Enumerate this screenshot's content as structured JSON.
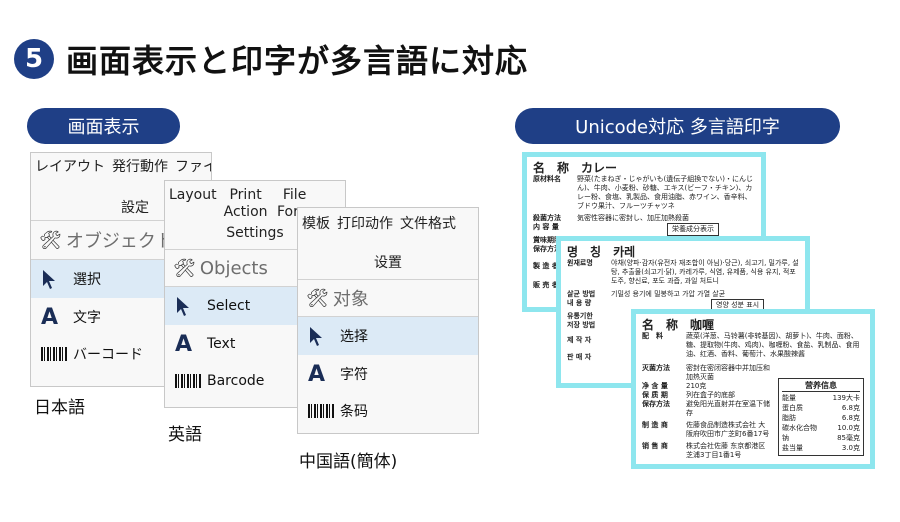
{
  "header": {
    "number": "5",
    "title": "画面表示と印字が多言語に対応"
  },
  "pills": {
    "left": "画面表示",
    "right": "Unicode対応 多言語印字"
  },
  "panels": {
    "ja": {
      "menu": [
        "レイアウト",
        "発行動作",
        "ファイル形"
      ],
      "group": "設定",
      "section": "オブジェクト",
      "items": [
        {
          "icon": "cursor-arrow-icon",
          "label": "選択"
        },
        {
          "icon": "text-a-icon",
          "label": "文字"
        },
        {
          "icon": "barcode-icon",
          "label": "バーコード"
        }
      ],
      "caption": "日本語"
    },
    "en": {
      "menu": [
        "Layout",
        "Print Action",
        "File Form"
      ],
      "group": "Settings",
      "section": "Objects",
      "items": [
        {
          "icon": "cursor-arrow-icon",
          "label": "Select"
        },
        {
          "icon": "text-a-icon",
          "label": "Text"
        },
        {
          "icon": "barcode-icon",
          "label": "Barcode"
        }
      ],
      "caption": "英語"
    },
    "zh": {
      "menu": [
        "模板",
        "打印动作",
        "文件格式"
      ],
      "group": "设置",
      "section": "对象",
      "items": [
        {
          "icon": "cursor-arrow-icon",
          "label": "选择"
        },
        {
          "icon": "text-a-icon",
          "label": "字符"
        },
        {
          "icon": "barcode-icon",
          "label": "条码"
        }
      ],
      "caption": "中国語(簡体)"
    }
  },
  "labels": {
    "ja": {
      "title": "名　称　カレー",
      "rows": [
        {
          "k": "原材料名",
          "v": "野菜(たまねぎ・じゃがいも(遺伝子組換でない)・にんじん)、牛肉、小麦粉、砂糖、エキス(ビーフ・チキン)、カレー粉、食塩、乳製品、食用油脂、赤ワイン、香辛料、ブドウ果汁、フルーツチャツネ"
        },
        {
          "k": "殺菌方法",
          "v": "気密性容器に密封し、加圧加熱殺菌"
        },
        {
          "k": "内 容 量",
          "v": ""
        },
        {
          "k": "賞味期限",
          "v": ""
        },
        {
          "k": "保存方法",
          "v": ""
        },
        {
          "k": "製 造 者",
          "v": ""
        },
        {
          "k": "販 売 者",
          "v": ""
        }
      ],
      "box": "栄養成分表示"
    },
    "ko": {
      "title": "명　칭　카레",
      "rows": [
        {
          "k": "원재료명",
          "v": "야채(양파·감자(유전자 재조합이 아님)·당근), 쇠고기, 밀가루, 설탕, 추출물(쇠고기·닭), 카레가루, 식염, 유제품, 식용 유지, 적포도주, 향신료, 포도 과즙, 과일 처트니"
        },
        {
          "k": "살균 방법",
          "v": "기밀성 용기에 밀봉하고 가압 가열 살균"
        },
        {
          "k": "내 용 량",
          "v": ""
        },
        {
          "k": "유통기한",
          "v": ""
        },
        {
          "k": "저장 방법",
          "v": ""
        },
        {
          "k": "제 작 자",
          "v": ""
        },
        {
          "k": "판 매 자",
          "v": ""
        }
      ],
      "box": "영양 성분 표시"
    },
    "zh": {
      "title": "名　称　咖喱",
      "rows": [
        {
          "k": "配　料",
          "v": "蔬菜(洋葱、马铃薯(非转基因)、胡萝卜)、牛肉、面粉、糖、提取物(牛肉、鸡肉)、咖喱粉、食盐、乳制品、食用油、红酒、香料、葡萄汁、水果酸辣酱"
        },
        {
          "k": "灭菌方法",
          "v": "密封在密闭容器中并加压和加热灭菌"
        },
        {
          "k": "净 含 量",
          "v": "210克"
        },
        {
          "k": "保 质 期",
          "v": "列在盒子的底部"
        },
        {
          "k": "保存方法",
          "v": "避免阳光直射并在室温下储存"
        },
        {
          "k": "制 造 商",
          "v": "佐藤食品制造株式会社 大阪府吹田市广芝町6番17号"
        },
        {
          "k": "销 售 商",
          "v": "株式会社佐藤 东京都港区芝浦3丁目1番1号"
        }
      ],
      "nutrition": {
        "title": "营养信息",
        "rows": [
          {
            "k": "能量",
            "v": "139大卡"
          },
          {
            "k": "蛋白质",
            "v": "6.8克"
          },
          {
            "k": "脂肪",
            "v": "6.8克"
          },
          {
            "k": "碳水化合物",
            "v": "10.0克"
          },
          {
            "k": "钠",
            "v": "85毫克"
          },
          {
            "k": "盐当量",
            "v": "3.0克"
          }
        ]
      }
    }
  },
  "colors": {
    "brand_navy": "#1f3f86",
    "label_cyan": "#8ee6ee",
    "selected_row": "#dceaf6"
  }
}
